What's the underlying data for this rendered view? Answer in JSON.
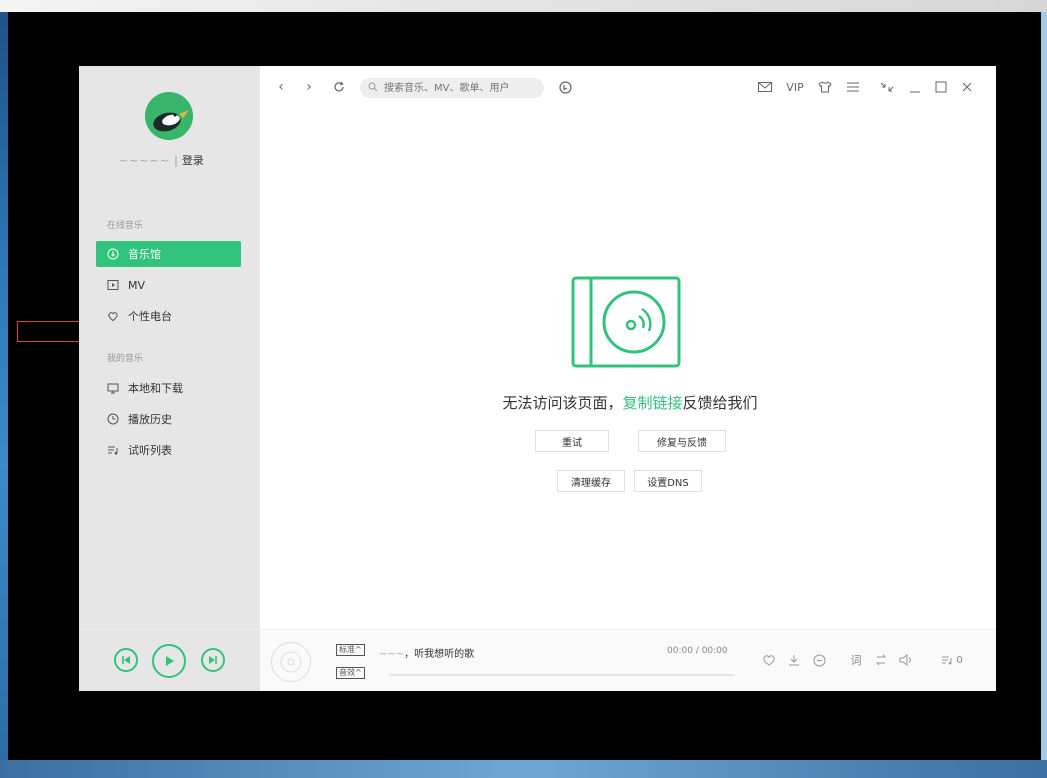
{
  "colors": {
    "accent": "#31c27c",
    "sidebar_bg": "#e6e6e6",
    "frame_bg": "#000000"
  },
  "user": {
    "name_blur": "~~~~~",
    "login_label": "登录"
  },
  "sidebar": {
    "online_title": "在线音乐",
    "online_items": [
      {
        "label": "音乐馆",
        "icon": "music-hall-icon",
        "active": true
      },
      {
        "label": "MV",
        "icon": "mv-icon"
      },
      {
        "label": "个性电台",
        "icon": "radio-icon"
      }
    ],
    "my_title": "我的音乐",
    "my_items": [
      {
        "label": "本地和下载",
        "icon": "monitor-icon"
      },
      {
        "label": "播放历史",
        "icon": "clock-icon"
      },
      {
        "label": "试听列表",
        "icon": "playlist-icon"
      }
    ]
  },
  "topbar": {
    "search_placeholder": "搜索音乐、MV、歌单、用户",
    "vip": "VIP"
  },
  "error": {
    "text_before": "无法访问该页面，",
    "link_text": "复制链接",
    "text_after": "反馈给我们",
    "buttons": {
      "retry": "重试",
      "repair": "修复与反馈",
      "clear_cache": "清理缓存",
      "dns": "设置DNS"
    }
  },
  "player": {
    "quality_tag": "标准",
    "effect_tag": "音效",
    "song_prefix_blur": "~~~",
    "song_text": "，听我想听的歌",
    "time": "00:00 / 00:00",
    "lyric_label": "词",
    "playlist_count": "0"
  }
}
